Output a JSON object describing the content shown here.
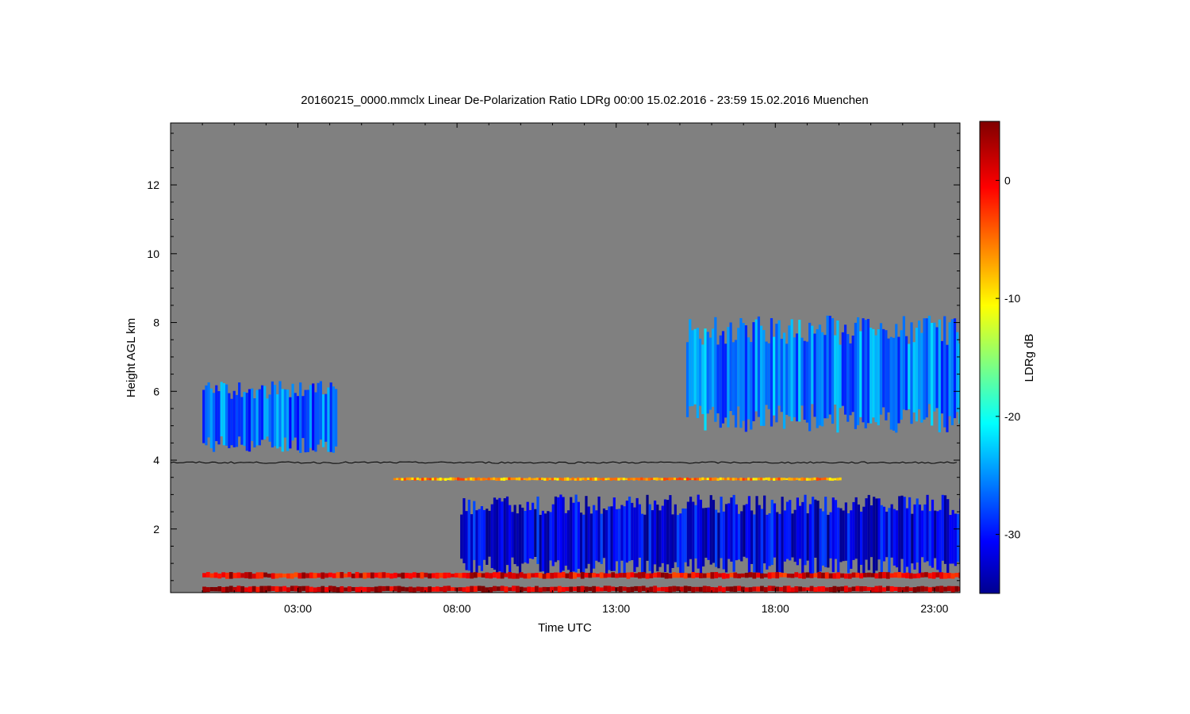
{
  "chart_data": {
    "type": "heatmap",
    "title": "20160215_0000.mmclx Linear De-Polarization Ratio LDRg   00:00 15.02.2016 - 23:59 15.02.2016 Muenchen",
    "xlabel": "Time UTC",
    "ylabel": "Height AGL km",
    "colorbar_label": "LDRg dB",
    "x_range_hours": [
      0,
      24
    ],
    "y_range_km": [
      0.15,
      13.8
    ],
    "x_ticks": [
      {
        "value": 3,
        "label": "03:00"
      },
      {
        "value": 8,
        "label": "08:00"
      },
      {
        "value": 13,
        "label": "13:00"
      },
      {
        "value": 18,
        "label": "18:00"
      },
      {
        "value": 23,
        "label": "23:00"
      }
    ],
    "y_ticks": [
      {
        "value": 2,
        "label": "2"
      },
      {
        "value": 4,
        "label": "4"
      },
      {
        "value": 6,
        "label": "6"
      },
      {
        "value": 8,
        "label": "8"
      },
      {
        "value": 10,
        "label": "10"
      },
      {
        "value": 12,
        "label": "12"
      }
    ],
    "colorbar_range_db": [
      -35,
      5
    ],
    "colorbar_ticks": [
      {
        "value": 0,
        "label": "0"
      },
      {
        "value": -10,
        "label": "-10"
      },
      {
        "value": -20,
        "label": "-20"
      },
      {
        "value": -30,
        "label": "-30"
      }
    ],
    "colormap": "jet",
    "no_data_color": "#808080",
    "reference_line_km": 3.93,
    "regions": [
      {
        "name": "cirrus-early",
        "t": [
          0.0,
          4.2
        ],
        "h": [
          4.2,
          6.3
        ],
        "ldr_db": -26
      },
      {
        "name": "cirrus-late",
        "t": [
          15.2,
          24.0
        ],
        "h": [
          4.8,
          8.2
        ],
        "ldr_db": -25
      },
      {
        "name": "low-cloud-day",
        "t": [
          8.1,
          24.0
        ],
        "h": [
          0.6,
          3.0
        ],
        "ldr_db": -31
      },
      {
        "name": "near-surface-band-upper",
        "t": [
          0.0,
          24.0
        ],
        "h": [
          0.55,
          0.75
        ],
        "ldr_db": 1
      },
      {
        "name": "near-surface-band-lower",
        "t": [
          0.0,
          24.0
        ],
        "h": [
          0.15,
          0.35
        ],
        "ldr_db": 3
      },
      {
        "name": "sparse-echo-line",
        "t": [
          6.0,
          20.0
        ],
        "h": [
          3.4,
          3.5
        ],
        "ldr_db": -6
      }
    ]
  }
}
